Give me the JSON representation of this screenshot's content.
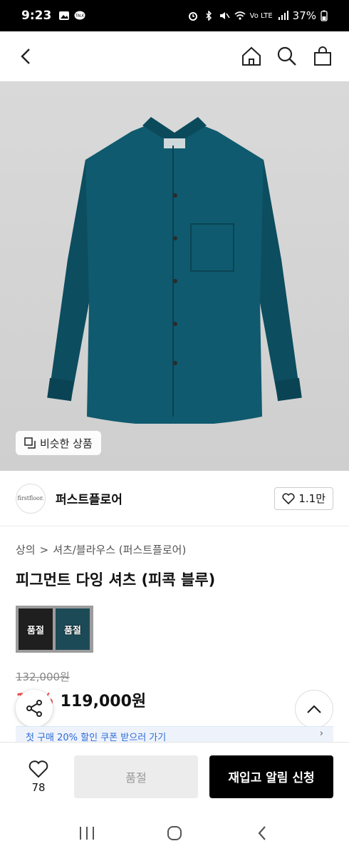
{
  "status_bar": {
    "time": "9:23",
    "battery": "37%",
    "network": "Vo LTE"
  },
  "nav": {
    "back_icon": "chevron-left-icon",
    "home_icon": "home-icon",
    "search_icon": "search-icon",
    "bag_icon": "shopping-bag-icon"
  },
  "hero": {
    "similar_label": "비슷한 상품",
    "product_color": "#0f5a6e"
  },
  "brand": {
    "logo_text": "firstfloor.",
    "name": "퍼스트플로어",
    "likes": "1.1만"
  },
  "breadcrumb": {
    "category": "상의",
    "separator": ">",
    "subcategory": "셔츠/블라우스 (퍼스트플로어)"
  },
  "product": {
    "title": "피그먼트 다잉 셔츠 (피콕 블루)",
    "original_price": "132,000원",
    "discount": "10%",
    "sale_price": "119,000원"
  },
  "options": [
    {
      "name": "black",
      "label": "품절",
      "color": "#1f1f1f"
    },
    {
      "name": "peacock-blue",
      "label": "품절",
      "color": "#1d4a57"
    }
  ],
  "coupon": {
    "text": "첫 구매 20% 할인 쿠폰 받으러 가기",
    "arrow": "›"
  },
  "bottom_bar": {
    "wish_count": "78",
    "soldout_label": "품절",
    "restock_label": "재입고 알림 신청"
  }
}
